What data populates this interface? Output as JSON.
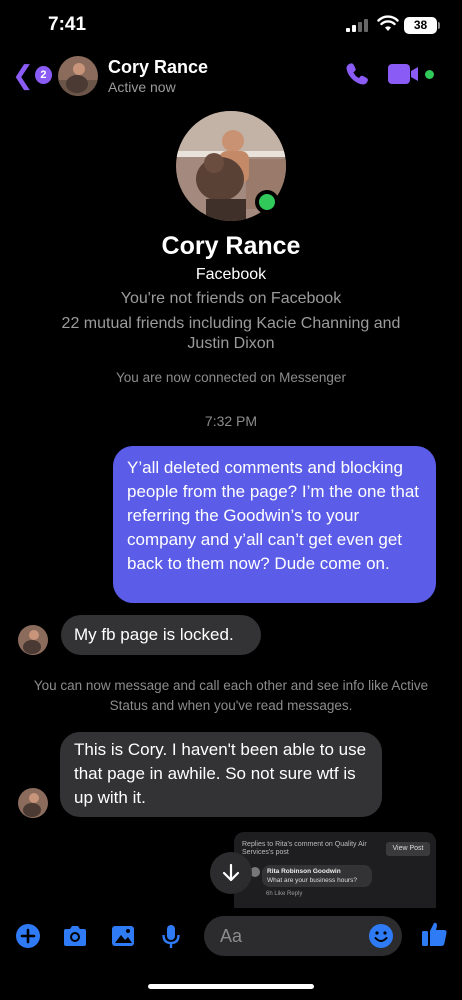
{
  "status_bar": {
    "time": "7:41",
    "battery": "38"
  },
  "header": {
    "back_badge": "2",
    "name": "Cory Rance",
    "presence": "Active now",
    "icons": [
      "back-chevron-icon",
      "phone-icon",
      "video-camera-icon"
    ]
  },
  "profile": {
    "name": "Cory Rance",
    "platform": "Facebook",
    "friendship": "You're not friends on Facebook",
    "mutual": "22 mutual friends including Kacie Channing and Justin Dixon"
  },
  "conversation": {
    "connected_notice": "You are now connected on Messenger",
    "timestamp": "7:32 PM",
    "outgoing_1": "Y’all deleted comments and blocking people from the page? I’m the one that referring the Goodwin’s to your company and y’all can’t get even get back to them now? Dude come on.",
    "incoming_1": "My fb page is locked.",
    "system_notice": "You can now message and call each other and see info like Active Status and when you've read messages.",
    "incoming_2": "This is Cory.  I haven't been able to use that page in awhile. So not sure wtf is up with it.",
    "shared_post": {
      "header": "Replies to Rita's comment on Quality Air Services's post",
      "view_button": "View Post",
      "commenter": "Rita Robinson Goodwin",
      "comment_text": "What are your business hours?",
      "meta": "6h   Like   Reply"
    }
  },
  "composer": {
    "placeholder": "Aa",
    "icons": [
      "plus-icon",
      "camera-icon",
      "photo-icon",
      "microphone-icon",
      "emoji-icon",
      "thumbs-up-icon"
    ]
  },
  "colors": {
    "accent": "#8a5cf5",
    "outgoing_bubble": "#5b5ce8",
    "incoming_bubble": "#333335",
    "online": "#31c95a",
    "composer_icon": "#2f7bf6"
  }
}
